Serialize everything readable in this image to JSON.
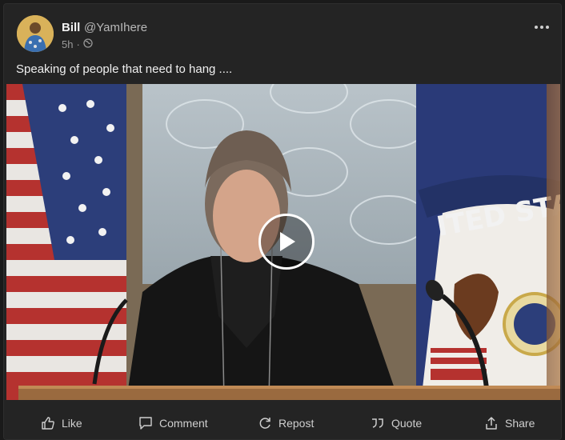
{
  "post": {
    "author_name": "Bill",
    "author_handle": "@YamIhere",
    "time_ago": "5h",
    "separator": "·",
    "text": "Speaking of people that need to hang ...."
  },
  "actions": {
    "like": "Like",
    "comment": "Comment",
    "repost": "Repost",
    "quote": "Quote",
    "share": "Share"
  },
  "icons": {
    "visibility": "globe-icon",
    "more": "more-options-icon",
    "play": "play-icon"
  },
  "colors": {
    "card_bg": "#242424",
    "text_primary": "#f0f0f0",
    "text_secondary": "#9a9a9a"
  }
}
